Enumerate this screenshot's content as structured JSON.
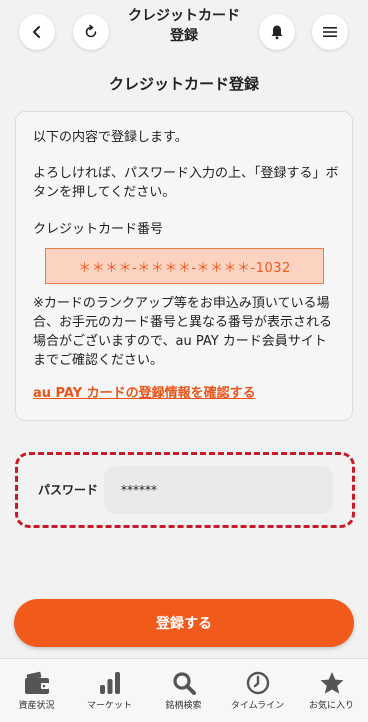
{
  "header": {
    "title": "クレジットカード\n登録"
  },
  "page": {
    "title": "クレジットカード登録"
  },
  "card": {
    "intro": "以下の内容で登録します。",
    "instruction": "よろしければ、パスワード入力の上、「登録する」ボタンを押してください。",
    "card_number_label": "クレジットカード番号",
    "card_number": "＊＊＊＊-＊＊＊＊-＊＊＊＊-1032",
    "notice": "※カードのランクアップ等をお申込み頂いている場合、お手元のカード番号と異なる番号が表示される場合がございますので、au PAY カード会員サイトまでご確認ください。",
    "link": "au PAY カードの登録情報を確認する"
  },
  "password": {
    "label": "パスワード",
    "value": "******"
  },
  "submit_label": "登録する",
  "nav": {
    "items": [
      {
        "label": "資産状況",
        "icon": "wallet-icon"
      },
      {
        "label": "マーケット",
        "icon": "bar-chart-icon"
      },
      {
        "label": "銘柄検索",
        "icon": "search-icon"
      },
      {
        "label": "タイムライン",
        "icon": "clock-icon"
      },
      {
        "label": "お気に入り",
        "icon": "star-icon"
      }
    ]
  },
  "colors": {
    "accent": "#f25a1c",
    "card_number_bg": "#fcd3c0",
    "dashed_frame": "#c81a2a",
    "icon_dark": "#555555"
  }
}
